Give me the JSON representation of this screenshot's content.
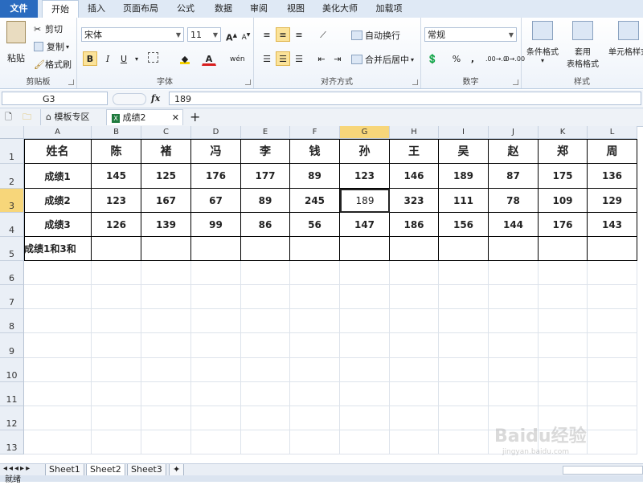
{
  "ribbon_tabs": [
    "文件",
    "开始",
    "插入",
    "页面布局",
    "公式",
    "数据",
    "审阅",
    "视图",
    "美化大师",
    "加载项"
  ],
  "active_tab_index": 1,
  "clipboard": {
    "paste": "粘贴",
    "cut": "剪切",
    "copy": "复制",
    "format_painter": "格式刷",
    "group": "剪贴板"
  },
  "font": {
    "name": "宋体",
    "size": "11",
    "group": "字体",
    "bold": "B",
    "italic": "I",
    "underline": "U",
    "grow": "A",
    "shrink": "A",
    "font_color": "A",
    "phonetic": "wén"
  },
  "alignment": {
    "wrap": "自动换行",
    "merge": "合并后居中",
    "group": "对齐方式"
  },
  "number": {
    "format": "常规",
    "percent": "%",
    "comma": ",",
    "inc_decimal": ".00→.0",
    "dec_decimal": ".0→.00",
    "group": "数字"
  },
  "styles": {
    "conditional": "条件格式",
    "table": "套用表格格式",
    "cell": "单元格样式",
    "table_l1": "套用",
    "table_l2": "表格格式",
    "group": "样式"
  },
  "formula_bar": {
    "cell_ref": "G3",
    "fx": "fx",
    "value": "189"
  },
  "doc_tabs": {
    "template": "模板专区",
    "file": "成绩2",
    "add": "+"
  },
  "columns": [
    "A",
    "B",
    "C",
    "D",
    "E",
    "F",
    "G",
    "H",
    "I",
    "J",
    "K",
    "L"
  ],
  "selected_column": "G",
  "rows": [
    "1",
    "2",
    "3",
    "4",
    "5",
    "6",
    "7",
    "8",
    "9",
    "10",
    "11",
    "12",
    "13"
  ],
  "selected_row": "3",
  "table": {
    "header": [
      "姓名",
      "陈",
      "褚",
      "冯",
      "李",
      "钱",
      "孙",
      "王",
      "吴",
      "赵",
      "郑",
      "周"
    ],
    "data": [
      [
        "成绩1",
        "145",
        "125",
        "176",
        "177",
        "89",
        "123",
        "146",
        "189",
        "87",
        "175",
        "136"
      ],
      [
        "成绩2",
        "123",
        "167",
        "67",
        "89",
        "245",
        "189",
        "323",
        "111",
        "78",
        "109",
        "129"
      ],
      [
        "成绩3",
        "126",
        "139",
        "99",
        "86",
        "56",
        "147",
        "186",
        "156",
        "144",
        "176",
        "143"
      ],
      [
        "成绩1和3和",
        "",
        "",
        "",
        "",
        "",
        "",
        "",
        "",
        "",
        "",
        ""
      ]
    ]
  },
  "sheets": [
    "Sheet1",
    "Sheet2",
    "Sheet3"
  ],
  "active_sheet": "Sheet2",
  "status": "就绪",
  "watermark": {
    "brand": "Baidu经验",
    "url": "jingyan.baidu.com"
  }
}
